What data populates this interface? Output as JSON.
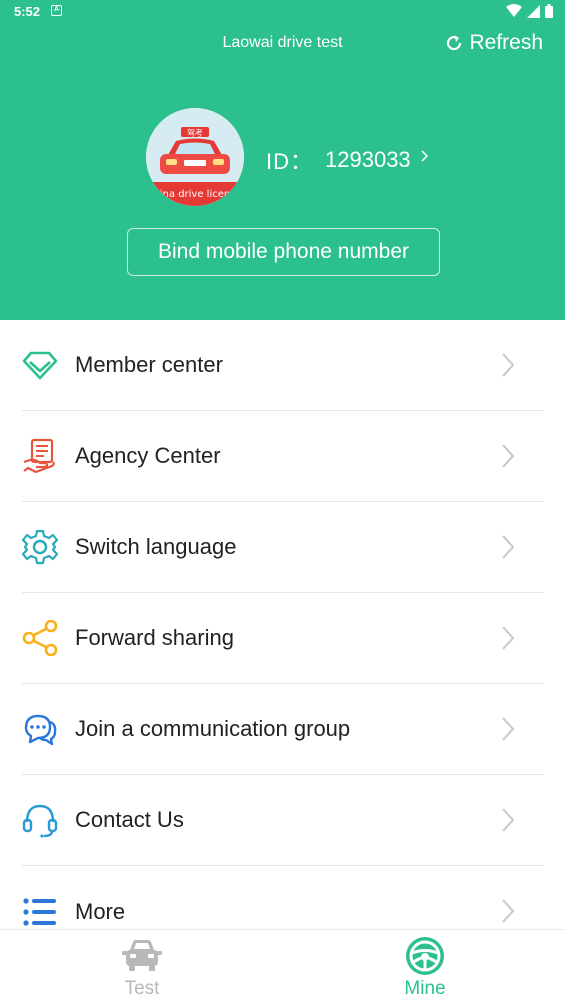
{
  "status_bar": {
    "time": "5:52",
    "notification_glyph": "A"
  },
  "header": {
    "title": "Laowai drive test",
    "refresh_label": "Refresh",
    "avatar_caption": "ina drive licen",
    "avatar_badge": "驾考",
    "id_label": "ID：",
    "id_value": "1293033",
    "bind_phone_label": "Bind mobile phone number",
    "background_color": "#2bc08e"
  },
  "menu": {
    "items": [
      {
        "label": "Member center",
        "icon": "diamond-icon",
        "color": "#2bc08e"
      },
      {
        "label": "Agency Center",
        "icon": "agency-icon",
        "color": "#e8553e"
      },
      {
        "label": "Switch language",
        "icon": "gear-icon",
        "color": "#2aa9b8"
      },
      {
        "label": "Forward sharing",
        "icon": "share-icon",
        "color": "#f5b21b"
      },
      {
        "label": "Join a communication group",
        "icon": "chat-icon",
        "color": "#2b78d8"
      },
      {
        "label": "Contact Us",
        "icon": "headset-icon",
        "color": "#2b9ad8"
      },
      {
        "label": "More",
        "icon": "list-icon",
        "color": "#2b78d8"
      }
    ]
  },
  "tabbar": {
    "tabs": [
      {
        "label": "Test",
        "icon": "car-icon",
        "active": false
      },
      {
        "label": "Mine",
        "icon": "steering-wheel-icon",
        "active": true
      }
    ],
    "active_color": "#2bc08e",
    "inactive_color": "#b8b8b8"
  }
}
